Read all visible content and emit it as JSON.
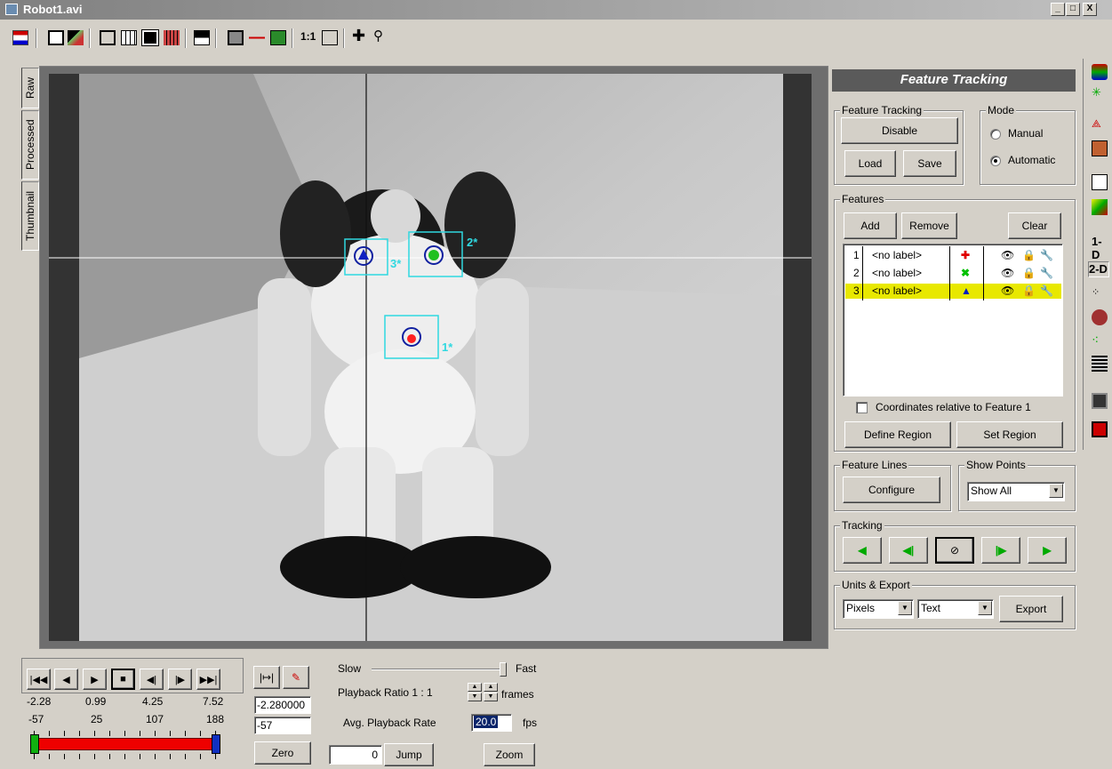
{
  "window": {
    "title": "Robot1.avi",
    "buttons": [
      "_",
      "□",
      "X"
    ]
  },
  "toolbar_icons": [
    "film-icon",
    "frame-icon",
    "image-icon",
    "window-icon",
    "grid-icon",
    "picture-icon",
    "filmstrip-icon",
    "split-icon",
    "overlay-icon",
    "line-icon",
    "color-icon",
    "ratio-icon",
    "fit-icon",
    "crosshair-icon",
    "zoom-icon"
  ],
  "toolbar_ratio": "1:1",
  "tabs": [
    "Raw",
    "Processed",
    "Thumbnail"
  ],
  "video": {
    "feature_markers": [
      {
        "label": "1*",
        "color": "#ff2020"
      },
      {
        "label": "2*",
        "color": "#20c020"
      },
      {
        "label": "3*",
        "color": "#1020c0"
      }
    ]
  },
  "panel": {
    "header": "Feature Tracking",
    "feature_tracking": {
      "title": "Feature Tracking",
      "disable": "Disable",
      "load": "Load",
      "save": "Save"
    },
    "mode": {
      "title": "Mode",
      "manual": "Manual",
      "automatic": "Automatic",
      "selected": "Automatic"
    },
    "features": {
      "title": "Features",
      "add": "Add",
      "remove": "Remove",
      "clear": "Clear",
      "rows": [
        {
          "num": "1",
          "label": "<no label>",
          "marker": "✚",
          "marker_color": "#e00000",
          "selected": false
        },
        {
          "num": "2",
          "label": "<no label>",
          "marker": "✖",
          "marker_color": "#00c000",
          "selected": false
        },
        {
          "num": "3",
          "label": "<no label>",
          "marker": "▲",
          "marker_color": "#0020c0",
          "selected": true
        }
      ],
      "relative_checkbox": "Coordinates relative to Feature 1",
      "define_region": "Define Region",
      "set_region": "Set Region"
    },
    "feature_lines": {
      "title": "Feature Lines",
      "configure": "Configure"
    },
    "show_points": {
      "title": "Show Points",
      "value": "Show All"
    },
    "tracking": {
      "title": "Tracking"
    },
    "units_export": {
      "title": "Units & Export",
      "units": "Pixels",
      "format": "Text",
      "export": "Export"
    }
  },
  "right_toolbar_labels": {
    "one_d": "1-D",
    "two_d": "2-D"
  },
  "playback": {
    "times": [
      "-2.28",
      "0.99",
      "4.25",
      "7.52"
    ],
    "frames": [
      "-57",
      "25",
      "107",
      "188"
    ],
    "current_time": "-2.280000",
    "current_frame": "-57",
    "zero": "Zero",
    "slow": "Slow",
    "fast": "Fast",
    "ratio_label": "Playback Ratio 1 : 1",
    "frames_label": "frames",
    "avg_label": "Avg. Playback Rate",
    "avg_value": "20.0",
    "fps": "fps",
    "jump_value": "0",
    "jump": "Jump",
    "zoom": "Zoom"
  }
}
